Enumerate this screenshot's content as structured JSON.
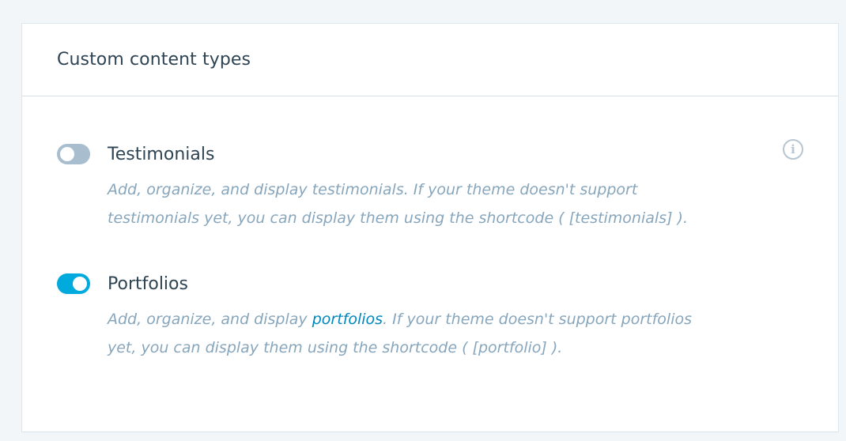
{
  "card": {
    "title": "Custom content types"
  },
  "settings": [
    {
      "label": "Testimonials",
      "enabled": false,
      "desc_line1": "Add, organize, and display testimonials. If your theme doesn't support",
      "desc_line2": "testimonials yet, you can display them using the shortcode ( [testimonials] )."
    },
    {
      "label": "Portfolios",
      "enabled": true,
      "desc_line1_pre": "Add, organize, and display ",
      "desc_line1_link": "portfolios",
      "desc_line1_post": ". If your theme doesn't support portfolios",
      "desc_line2": "yet, you can display them using the shortcode ( [portfolio] )."
    }
  ],
  "icons": {
    "info": "info-icon",
    "info_glyph": "i"
  },
  "colors": {
    "accent": "#00aadc",
    "toggle_off": "#a8bece",
    "link": "#0087be",
    "description": "#87a6bc"
  }
}
